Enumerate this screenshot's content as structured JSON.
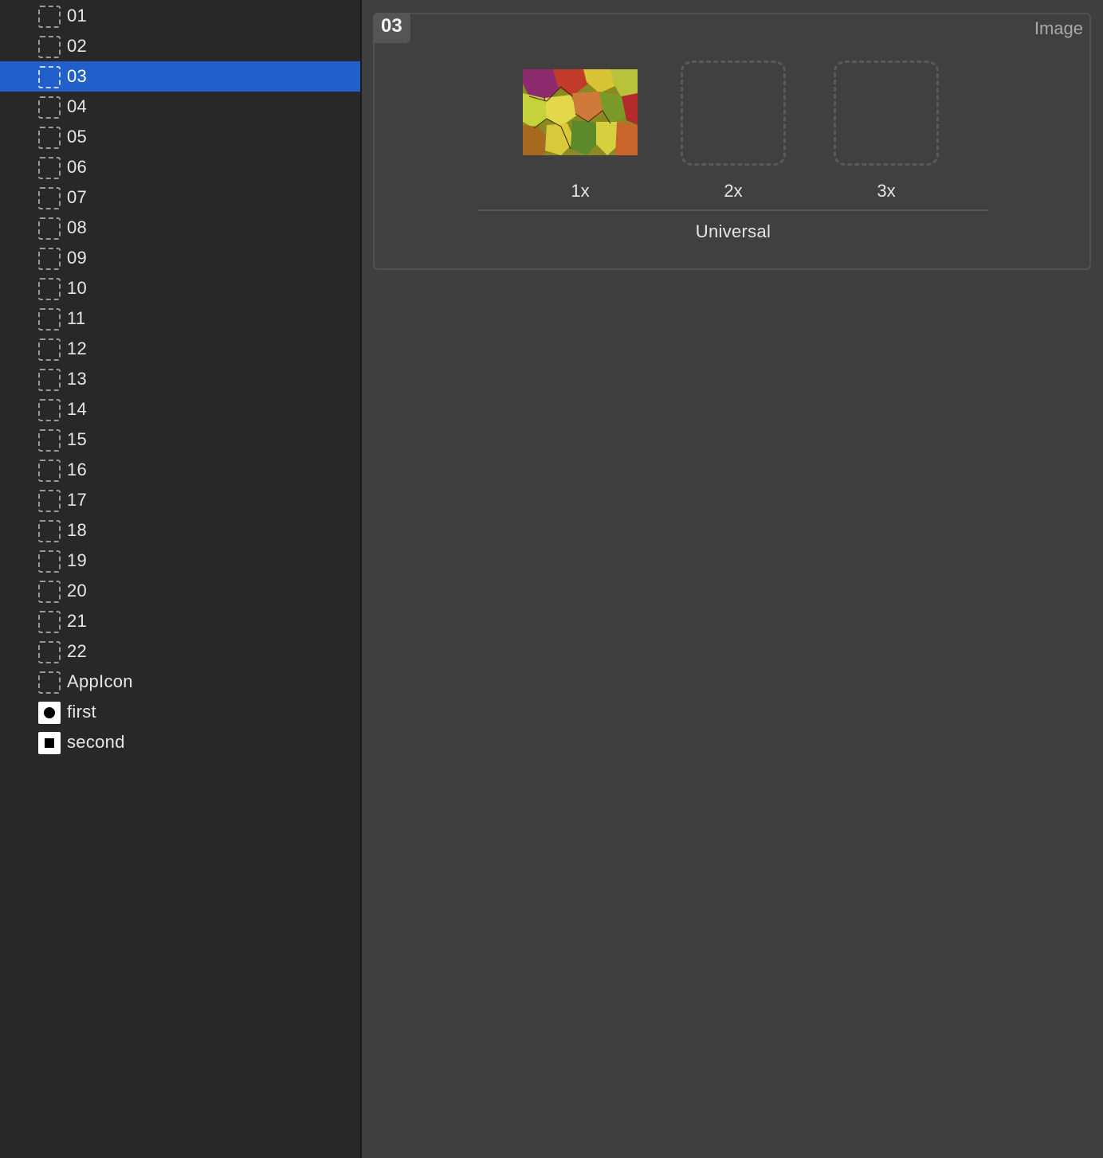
{
  "sidebar": {
    "items": [
      {
        "label": "01",
        "icon": "dashed-square-icon"
      },
      {
        "label": "02",
        "icon": "dashed-square-icon"
      },
      {
        "label": "03",
        "icon": "dashed-square-icon",
        "selected": true
      },
      {
        "label": "04",
        "icon": "dashed-square-icon"
      },
      {
        "label": "05",
        "icon": "dashed-square-icon"
      },
      {
        "label": "06",
        "icon": "dashed-square-icon"
      },
      {
        "label": "07",
        "icon": "dashed-square-icon"
      },
      {
        "label": "08",
        "icon": "dashed-square-icon"
      },
      {
        "label": "09",
        "icon": "dashed-square-icon"
      },
      {
        "label": "10",
        "icon": "dashed-square-icon"
      },
      {
        "label": "11",
        "icon": "dashed-square-icon"
      },
      {
        "label": "12",
        "icon": "dashed-square-icon"
      },
      {
        "label": "13",
        "icon": "dashed-square-icon"
      },
      {
        "label": "14",
        "icon": "dashed-square-icon"
      },
      {
        "label": "15",
        "icon": "dashed-square-icon"
      },
      {
        "label": "16",
        "icon": "dashed-square-icon"
      },
      {
        "label": "17",
        "icon": "dashed-square-icon"
      },
      {
        "label": "18",
        "icon": "dashed-square-icon"
      },
      {
        "label": "19",
        "icon": "dashed-square-icon"
      },
      {
        "label": "20",
        "icon": "dashed-square-icon"
      },
      {
        "label": "21",
        "icon": "dashed-square-icon"
      },
      {
        "label": "22",
        "icon": "dashed-square-icon"
      },
      {
        "label": "AppIcon",
        "icon": "dashed-square-icon"
      },
      {
        "label": "first",
        "icon": "circle-tab-icon"
      },
      {
        "label": "second",
        "icon": "square-tab-icon"
      }
    ],
    "selected_color": "#2160cb"
  },
  "asset": {
    "name": "03",
    "type": "Image",
    "slots": [
      {
        "label": "1x",
        "filled": true,
        "thumbnail": "autumn-leaves-image"
      },
      {
        "label": "2x",
        "filled": false
      },
      {
        "label": "3x",
        "filled": false
      }
    ],
    "group_label": "Universal"
  }
}
